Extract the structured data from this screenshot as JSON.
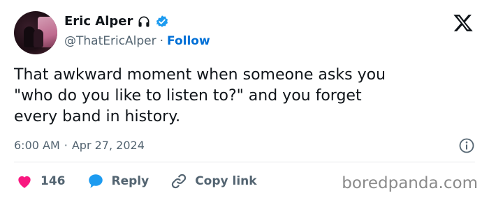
{
  "author": {
    "name": "Eric Alper",
    "handle": "@ThatEricAlper",
    "separator": "·",
    "follow_label": "Follow",
    "badge_icons": [
      "headphones-icon",
      "verified-icon"
    ]
  },
  "tweet": {
    "text": "That awkward moment when someone asks you\n\"who do you like to listen to?\" and you forget\nevery band in history.",
    "time": "6:00 AM",
    "separator": "·",
    "date": "Apr 27, 2024"
  },
  "actions": {
    "like_count": "146",
    "reply_label": "Reply",
    "copy_link_label": "Copy link"
  },
  "watermark": "boredpanda.com",
  "colors": {
    "accent": "#1d9bf0",
    "follow": "#006fd6",
    "heart": "#f91880",
    "text": "#0f1419",
    "muted": "#536471"
  }
}
